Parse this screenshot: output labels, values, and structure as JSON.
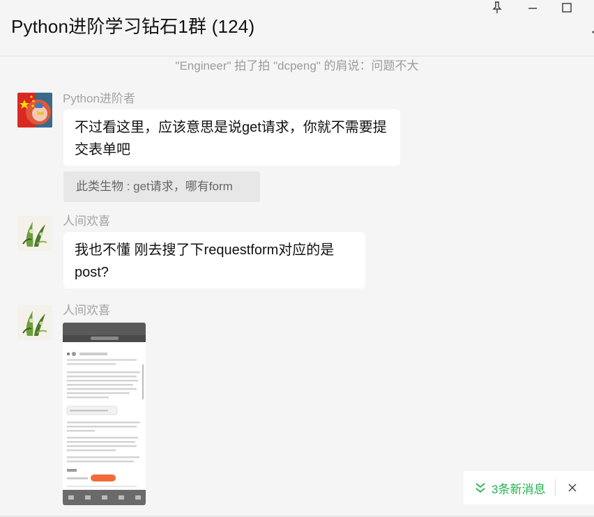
{
  "header": {
    "title": "Python进阶学习钻石1群 (124)"
  },
  "system_message": "\"Engineer\" 拍了拍 \"dcpeng\" 的肩说：问题不大",
  "messages": [
    {
      "sender": "Python进阶者",
      "text": "不过看这里，应该意思是说get请求，你就不需要提交表单吧",
      "quote": "此类生物 : get请求，哪有form"
    },
    {
      "sender": "人间欢喜",
      "text": "我也不懂 刚去搜了下requestform对应的是post?"
    },
    {
      "sender": "人间欢喜",
      "image": "phone-screenshot"
    }
  ],
  "new_messages": {
    "label": "3条新消息",
    "icon": "double-chevron-down-icon"
  },
  "colors": {
    "background": "#f5f5f5",
    "bubble": "#ffffff",
    "accent_green": "#22b14c",
    "muted_text": "#9b9b9b"
  }
}
